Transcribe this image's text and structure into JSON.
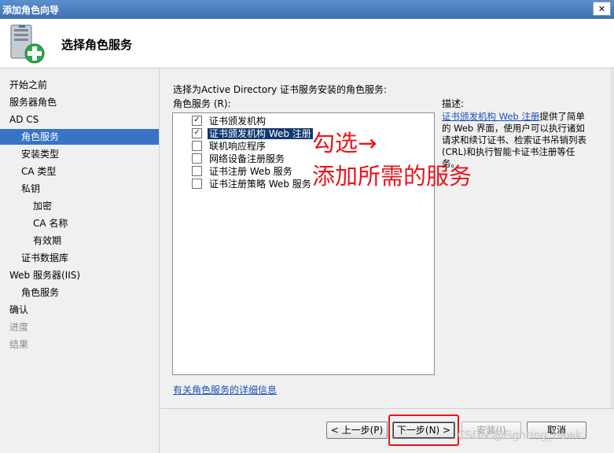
{
  "window": {
    "title": "添加角色向导",
    "close_label": "✕"
  },
  "header": {
    "title": "选择角色服务",
    "icon": "server-add-icon"
  },
  "nav": {
    "items": [
      {
        "label": "开始之前",
        "state": "normal"
      },
      {
        "label": "服务器角色",
        "state": "normal"
      },
      {
        "label": "AD CS",
        "state": "normal"
      },
      {
        "label": "角色服务",
        "state": "selected"
      },
      {
        "label": "安装类型",
        "state": "normal"
      },
      {
        "label": "CA 类型",
        "state": "normal"
      },
      {
        "label": "私钥",
        "state": "normal"
      },
      {
        "label": "加密",
        "state": "normal"
      },
      {
        "label": "CA 名称",
        "state": "normal"
      },
      {
        "label": "有效期",
        "state": "normal"
      },
      {
        "label": "证书数据库",
        "state": "normal"
      },
      {
        "label": "Web 服务器(IIS)",
        "state": "normal"
      },
      {
        "label": "角色服务",
        "state": "normal"
      },
      {
        "label": "确认",
        "state": "normal"
      },
      {
        "label": "进度",
        "state": "disabled"
      },
      {
        "label": "结果",
        "state": "disabled"
      }
    ]
  },
  "main": {
    "intro": "选择为Active Directory 证书服务安装的角色服务:",
    "list_label": "角色服务 (R):",
    "services": [
      {
        "label": "证书颁发机构",
        "checked": true
      },
      {
        "label": "证书颁发机构 Web 注册",
        "checked": true
      },
      {
        "label": "联机响应程序",
        "checked": false
      },
      {
        "label": "网络设备注册服务",
        "checked": false
      },
      {
        "label": "证书注册 Web 服务",
        "checked": false
      },
      {
        "label": "证书注册策略 Web 服务",
        "checked": false
      }
    ],
    "annotation_line1": "勾选→",
    "annotation_line2": "添加所需的服务",
    "desc_label": "描述:",
    "desc_link": "证书颁发机构 Web 注册",
    "desc_text": "提供了简单的 Web 界面，使用户可以执行诸如请求和续订证书、检索证书吊销列表(CRL)和执行智能卡证书注册等任务。",
    "detail_link": "有关角色服务的详细信息"
  },
  "buttons": {
    "back": "< 上一步(P)",
    "next": "下一步(N) >",
    "install": "安装(I)",
    "cancel": "取消"
  },
  "watermark": "CSDN @Fighting_hawk",
  "colors": {
    "accent": "#3873c6",
    "highlight": "#11386f",
    "annotation": "#e8141c"
  }
}
